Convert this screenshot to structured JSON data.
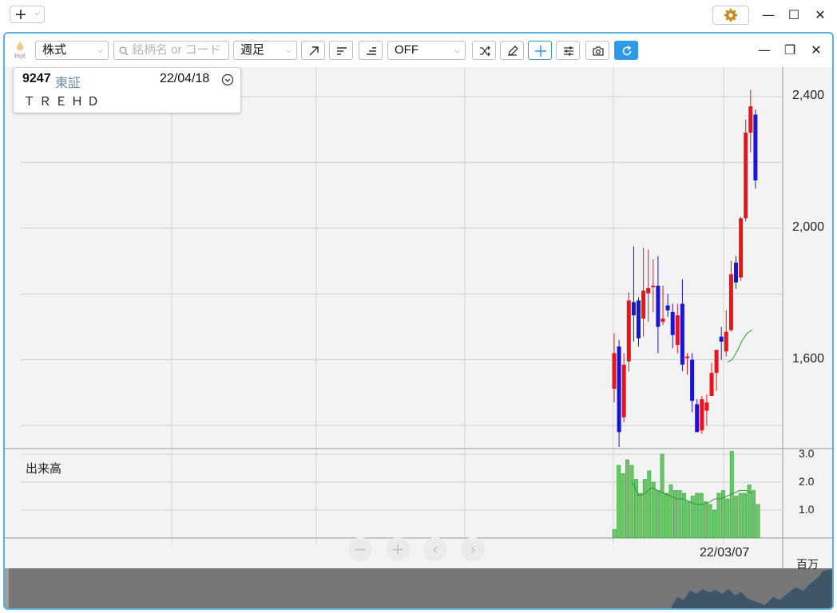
{
  "window": {
    "add_label": "+",
    "add_dropdown": "⌵",
    "gear_icon": "gear-icon",
    "minimize": "—",
    "maximize": "☐",
    "close": "✕"
  },
  "toolbar": {
    "hot_label": "Hot",
    "market_select": "株式",
    "search_placeholder": "銘柄名 or コード",
    "period_select": "週足",
    "indicator_select": "OFF",
    "accent": "#2d9be8"
  },
  "info": {
    "code": "9247",
    "exchange": "東証",
    "date": "22/04/18",
    "name": "ＴＲＥＨＤ"
  },
  "panel_controls": {
    "minimize": "—",
    "restore": "❐",
    "close": "✕"
  },
  "chart_data": {
    "type": "candlestick",
    "price_axis": {
      "ticks": [
        "2,400",
        "2,000",
        "1,600"
      ],
      "ylim": [
        1330,
        2470
      ]
    },
    "volume_label": "出来高",
    "volume_axis": {
      "ticks": [
        "3.0",
        "2.0",
        "1.0"
      ],
      "unit": "百万",
      "ylim": [
        0,
        3.2
      ]
    },
    "x_label": "22/03/07",
    "colors": {
      "up": "#e8141e",
      "down": "#1a14d6",
      "volume": "#2ea62e",
      "ma": "#2a9d2a"
    },
    "candles": [
      {
        "o": 1512,
        "h": 1680,
        "l": 1470,
        "c": 1620
      },
      {
        "o": 1640,
        "h": 1660,
        "l": 1335,
        "c": 1380
      },
      {
        "o": 1425,
        "h": 1620,
        "l": 1410,
        "c": 1585
      },
      {
        "o": 1595,
        "h": 1805,
        "l": 1565,
        "c": 1780
      },
      {
        "o": 1775,
        "h": 1945,
        "l": 1655,
        "c": 1735
      },
      {
        "o": 1780,
        "h": 1790,
        "l": 1640,
        "c": 1665
      },
      {
        "o": 1725,
        "h": 1940,
        "l": 1670,
        "c": 1810
      },
      {
        "o": 1802,
        "h": 1935,
        "l": 1715,
        "c": 1818
      },
      {
        "o": 1822,
        "h": 1905,
        "l": 1745,
        "c": 1825
      },
      {
        "o": 1825,
        "h": 1915,
        "l": 1620,
        "c": 1700
      },
      {
        "o": 1715,
        "h": 1825,
        "l": 1705,
        "c": 1725
      },
      {
        "o": 1765,
        "h": 1800,
        "l": 1730,
        "c": 1750
      },
      {
        "o": 1745,
        "h": 1770,
        "l": 1635,
        "c": 1675
      },
      {
        "o": 1645,
        "h": 1770,
        "l": 1620,
        "c": 1735
      },
      {
        "o": 1770,
        "h": 1845,
        "l": 1565,
        "c": 1585
      },
      {
        "o": 1605,
        "h": 1620,
        "l": 1555,
        "c": 1610
      },
      {
        "o": 1600,
        "h": 1620,
        "l": 1440,
        "c": 1475
      },
      {
        "o": 1465,
        "h": 1480,
        "l": 1390,
        "c": 1380
      },
      {
        "o": 1385,
        "h": 1490,
        "l": 1375,
        "c": 1480
      },
      {
        "o": 1445,
        "h": 1495,
        "l": 1400,
        "c": 1470
      },
      {
        "o": 1490,
        "h": 1590,
        "l": 1490,
        "c": 1560
      },
      {
        "o": 1560,
        "h": 1625,
        "l": 1505,
        "c": 1630
      },
      {
        "o": 1670,
        "h": 1700,
        "l": 1600,
        "c": 1655
      },
      {
        "o": 1625,
        "h": 1750,
        "l": 1610,
        "c": 1685
      },
      {
        "o": 1690,
        "h": 1900,
        "l": 1685,
        "c": 1860
      },
      {
        "o": 1895,
        "h": 1915,
        "l": 1815,
        "c": 1835
      },
      {
        "o": 1850,
        "h": 2035,
        "l": 1840,
        "c": 2030
      },
      {
        "o": 2030,
        "h": 2330,
        "l": 2020,
        "c": 2290
      },
      {
        "o": 2290,
        "h": 2420,
        "l": 2230,
        "c": 2370
      },
      {
        "o": 2345,
        "h": 2360,
        "l": 2120,
        "c": 2145
      }
    ],
    "volume": [
      0.3,
      2.6,
      2.3,
      2.8,
      2.6,
      2.1,
      1.6,
      2.1,
      2.4,
      2.0,
      1.7,
      3.0,
      1.6,
      1.9,
      1.7,
      1.7,
      1.6,
      1.3,
      1.5,
      1.6,
      1.6,
      1.3,
      1.2,
      1.0,
      1.6,
      1.7,
      1.4,
      3.1,
      1.5,
      1.6,
      1.6,
      1.9,
      1.7,
      1.2
    ],
    "volume_ma": [
      2.0,
      1.5,
      1.6,
      1.8,
      1.7,
      1.6,
      1.5,
      1.4,
      1.4,
      1.3,
      1.2,
      1.2,
      1.25,
      1.4,
      1.4,
      1.5,
      1.6,
      1.7,
      1.7,
      1.6
    ]
  }
}
